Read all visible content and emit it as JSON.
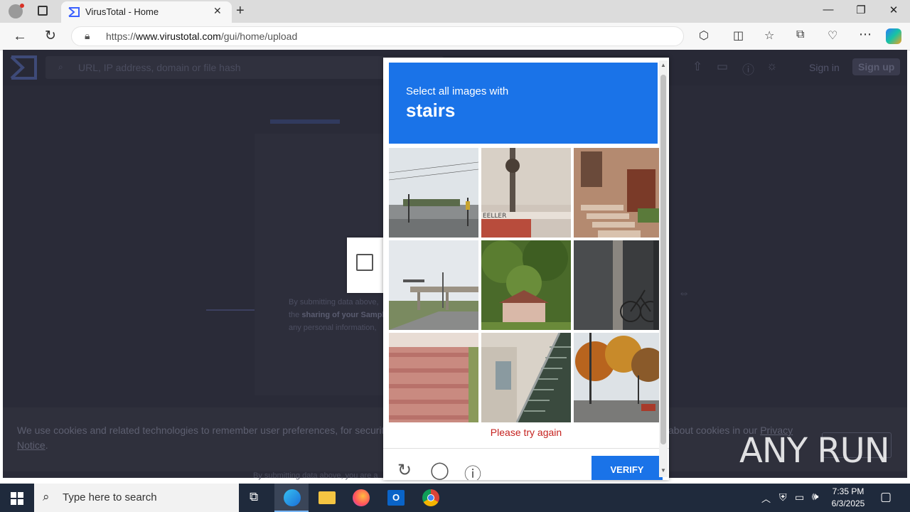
{
  "browser": {
    "tab_title": "VirusTotal - Home",
    "url_prefix": "https://",
    "url_host": "www.virustotal.com",
    "url_path": "/gui/home/upload"
  },
  "vt": {
    "search_placeholder": "URL, IP address, domain or file hash",
    "sign_in": "Sign in",
    "sign_up": "Sign up",
    "terms_line1": "By submitting data above,",
    "terms_line2_pre": "the ",
    "terms_line2_bold": "sharing of your Sampl",
    "terms_line3": "any personal information,",
    "footer": "By submitting data above, you are a",
    "cookie_text": "We use cookies and related technologies to remember user preferences, for security, to",
    "cookie_text_right": "about cookies in our",
    "cookie_link1": "Privacy",
    "cookie_link2": "Notice",
    "cookie_period": "."
  },
  "captcha": {
    "prompt": "Select all images with",
    "object": "stairs",
    "error": "Please try again",
    "verify": "VERIFY",
    "tiles": [
      {
        "name": "tile-traffic-intersection",
        "scene": "street"
      },
      {
        "name": "tile-storefront-pole",
        "scene": "storefront"
      },
      {
        "name": "tile-brownstone-stairs",
        "scene": "stairs-brown"
      },
      {
        "name": "tile-highway-overpass",
        "scene": "overpass"
      },
      {
        "name": "tile-trees-house",
        "scene": "trees"
      },
      {
        "name": "tile-bicycle-pole",
        "scene": "bicycle"
      },
      {
        "name": "tile-red-steps",
        "scene": "stairs-red"
      },
      {
        "name": "tile-exterior-staircase",
        "scene": "stairs-metal"
      },
      {
        "name": "tile-autumn-street",
        "scene": "autumn"
      }
    ]
  },
  "taskbar": {
    "search_placeholder": "Type here to search",
    "time": "7:35 PM",
    "date": "6/3/2025"
  },
  "watermark": "ANY RUN",
  "colors": {
    "accent": "#1a73e8",
    "error": "#c5221f",
    "vt_bg": "#2a2b38"
  }
}
